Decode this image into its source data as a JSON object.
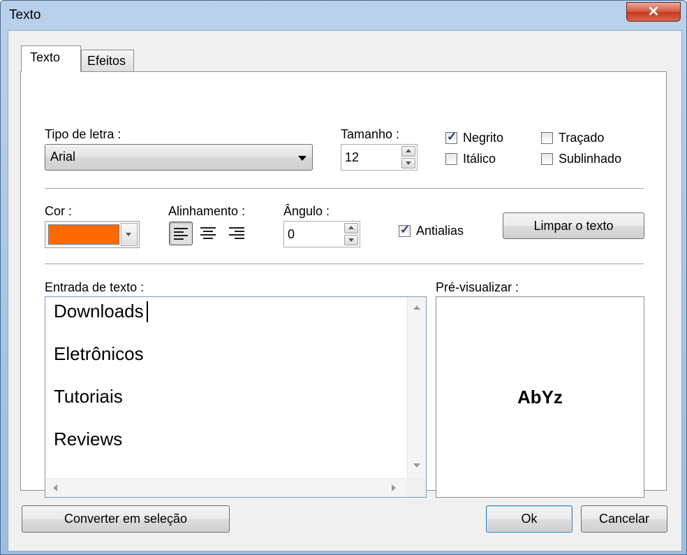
{
  "window": {
    "title": "Texto",
    "close_glyph": "✕"
  },
  "tabs": [
    {
      "label": "Texto",
      "active": true
    },
    {
      "label": "Efeitos",
      "active": false
    }
  ],
  "font": {
    "label": "Tipo de letra :",
    "value": "Arial"
  },
  "size": {
    "label": "Tamanho :",
    "value": "12"
  },
  "style_checks": {
    "bold": {
      "label": "Negrito",
      "checked": true
    },
    "italic": {
      "label": "Itálico",
      "checked": false
    },
    "strikeout": {
      "label": "Traçado",
      "checked": false
    },
    "underline": {
      "label": "Sublinhado",
      "checked": false
    }
  },
  "color": {
    "label": "Cor :",
    "value": "#ff6a00"
  },
  "alignment": {
    "label": "Alinhamento :",
    "options": [
      "left",
      "center",
      "right"
    ],
    "selected": "left"
  },
  "angle": {
    "label": "Ângulo :",
    "value": "0"
  },
  "antialias": {
    "label": "Antialias",
    "checked": true
  },
  "clear_button": {
    "label": "Limpar o texto"
  },
  "text_input": {
    "label": "Entrada de texto :",
    "lines": [
      "Downloads",
      "Eletrônicos",
      "Tutoriais",
      "Reviews"
    ]
  },
  "preview": {
    "label": "Pré-visualizar :",
    "sample": "AbYz"
  },
  "footer": {
    "convert_label": "Converter em seleção",
    "ok_label": "Ok",
    "cancel_label": "Cancelar"
  },
  "check_glyph": "✓"
}
